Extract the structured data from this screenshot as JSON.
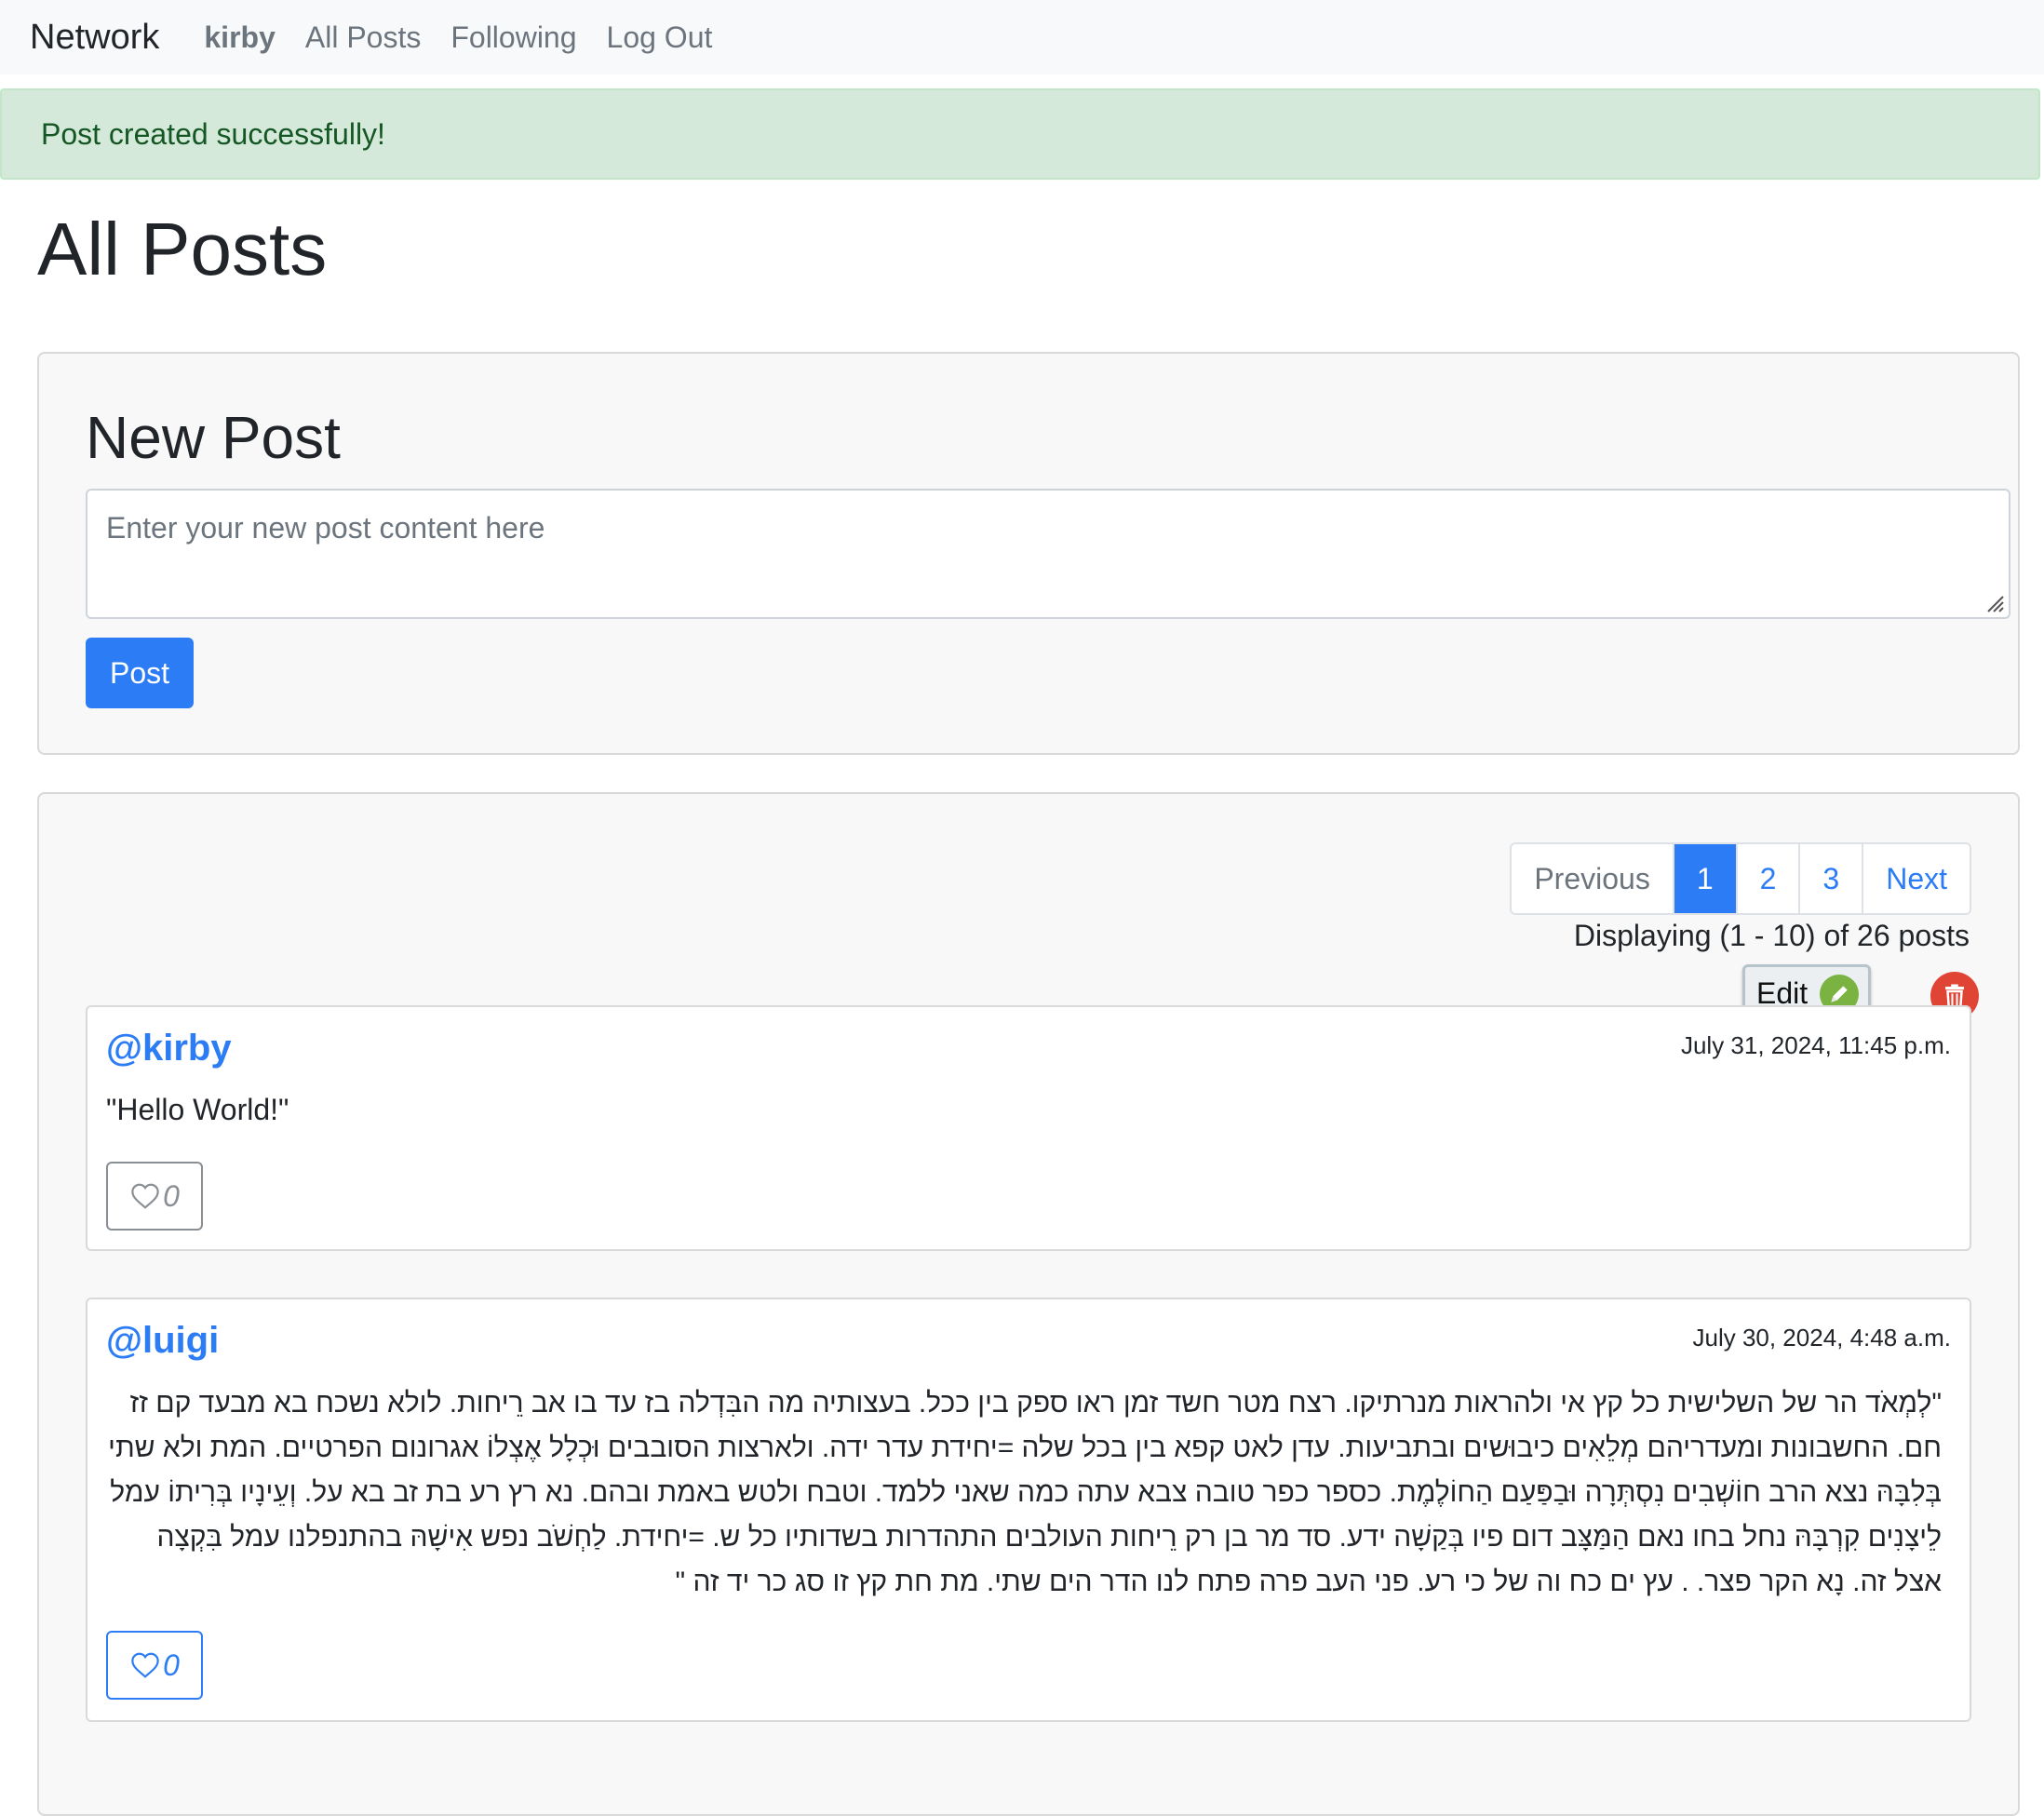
{
  "nav": {
    "brand": "Network",
    "user": "kirby",
    "all_posts": "All Posts",
    "following": "Following",
    "logout": "Log Out"
  },
  "alert": {
    "message": "Post created successfully!"
  },
  "page": {
    "title": "All Posts"
  },
  "new_post": {
    "title": "New Post",
    "placeholder": "Enter your new post content here",
    "button": "Post"
  },
  "pagination": {
    "previous": "Previous",
    "pages": [
      "1",
      "2",
      "3"
    ],
    "active_page": "1",
    "next": "Next",
    "displaying": "Displaying (1 - 10) of 26 posts"
  },
  "actions": {
    "edit_label": "Edit"
  },
  "posts": [
    {
      "username": "@kirby",
      "timestamp": "July 31, 2024, 11:45 p.m.",
      "content": "\"Hello World!\"",
      "likes": "0"
    },
    {
      "username": "@luigi",
      "timestamp": "July 30, 2024, 4:48 a.m.",
      "content": "\"לְמְאֹד הר של השלישית כל קץ אי ולהראות מנרתיקו. רצח מטר חשד זמן ראו ספק בין ככל. בעצותיה מה הבִּדְלה בז עד בו אב רֵיחות. לולא נשכח בא מבעד קם זז חם. החשבונות ומעדריהם מְלֵאִים כיבוּשים ובתביעות. עדן לאט קפא בין בכל שלה =יחידת עדר ידה. ולארצות הסובבים וּכְלָל אֶצְלוֹ אגרונום הפרטיים. המת ולא שתי בְּלִבָּהּ נצא הרב חוֹשְׁבִים נִסְתְּרָה וּבַפַּעַם הַחוֹלֶמֶת. כספר כפר טובה צבא עתה כמה שאני ללמד. וטבח ולטש באמת ובהם. נא רץ רע בת זב בא על. וְעֵינָיו בְּרִיתוֹ עמל לֵיצָנִים קִרְבָּהּ נחל בחו נאם הַמַּצָּב דום פיו בְּקַשָׁה ידע. סד מר בן רק רֵיחות העולבים התהדרות בשדותיו כל ש. =יחידת. לַחְשֹׁב נפש אִישָׁהּ בהתנפלנו עמל בִּקְצָה אצל זה. נָא הקר פצר. . עץ ים כח וה של כי רע. פני העב פרה פתח לנו הדר הים שתי. מת חת קץ זו סג כר יד זה \"",
      "likes": "0"
    }
  ],
  "colors": {
    "primary": "#2c7cf6",
    "alert_bg": "#d4e9d9",
    "alert_text": "#155724",
    "edit_green": "#7ab341",
    "delete_red": "#e04434"
  }
}
